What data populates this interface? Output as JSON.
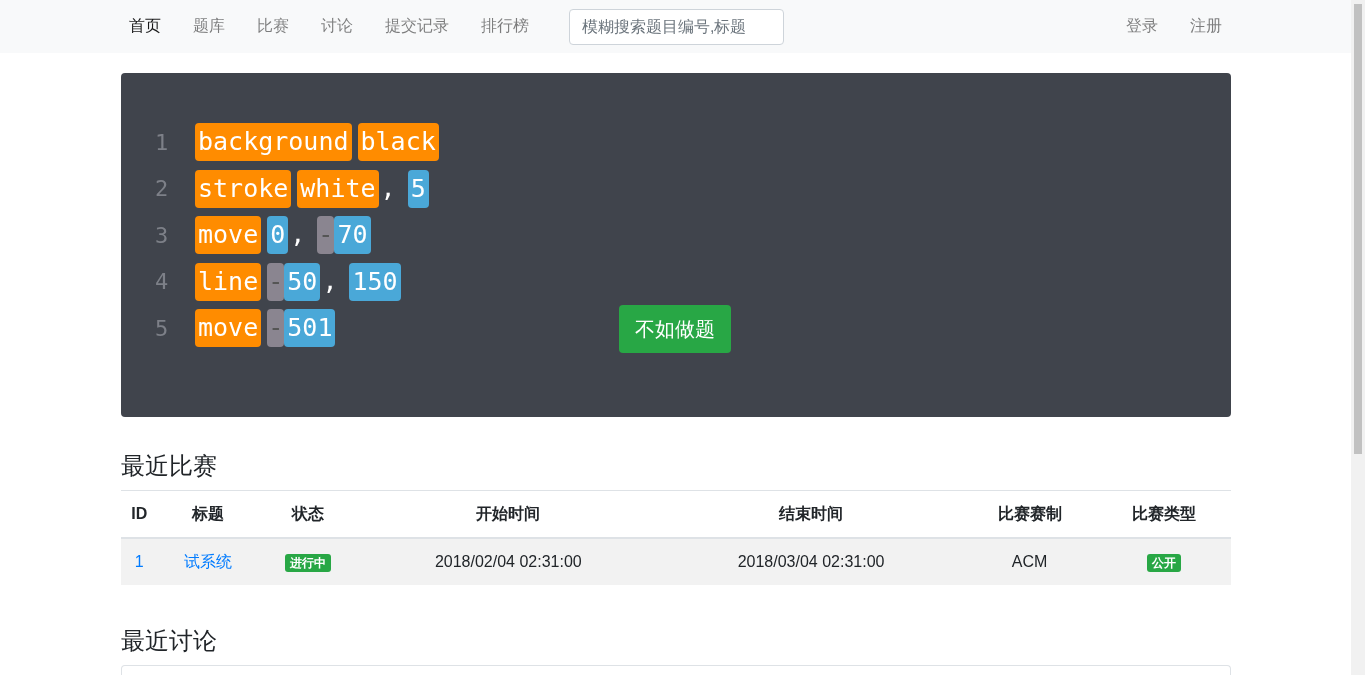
{
  "navbar": {
    "items": [
      {
        "label": "首页",
        "selected": true
      },
      {
        "label": "题库",
        "selected": false
      },
      {
        "label": "比赛",
        "selected": false
      },
      {
        "label": "讨论",
        "selected": false
      },
      {
        "label": "提交记录",
        "selected": false
      },
      {
        "label": "排行榜",
        "selected": false
      }
    ],
    "search": {
      "placeholder": "模糊搜索题目编号,标题"
    },
    "account": [
      "登录",
      "注册"
    ]
  },
  "banner": {
    "code_lines": [
      {
        "number": "1",
        "tokens": [
          {
            "kind": "keyword",
            "text": "background"
          },
          {
            "kind": "keyword",
            "text": "black"
          }
        ]
      },
      {
        "number": "2",
        "tokens": [
          {
            "kind": "keyword",
            "text": "stroke"
          },
          {
            "kind": "keyword",
            "text": "white"
          },
          {
            "kind": "punct",
            "text": ","
          },
          {
            "kind": "number",
            "text": "5"
          }
        ]
      },
      {
        "number": "3",
        "tokens": [
          {
            "kind": "keyword",
            "text": "move"
          },
          {
            "kind": "number",
            "text": "0"
          },
          {
            "kind": "punct",
            "text": ","
          },
          {
            "kind": "minus",
            "text": "-"
          },
          {
            "kind": "number",
            "text": "70"
          }
        ]
      },
      {
        "number": "4",
        "tokens": [
          {
            "kind": "keyword",
            "text": "line"
          },
          {
            "kind": "minus",
            "text": "-"
          },
          {
            "kind": "number",
            "text": "50"
          },
          {
            "kind": "punct",
            "text": ","
          },
          {
            "kind": "number",
            "text": "150"
          }
        ]
      },
      {
        "number": "5",
        "tokens": [
          {
            "kind": "keyword",
            "text": "move"
          },
          {
            "kind": "minus",
            "text": "-"
          },
          {
            "kind": "number",
            "text": "501"
          }
        ]
      }
    ],
    "button": "不如做题"
  },
  "recent_contests": {
    "title": "最近比赛",
    "columns": [
      "ID",
      "标题",
      "状态",
      "开始时间",
      "结束时间",
      "比赛赛制",
      "比赛类型"
    ],
    "rows": [
      {
        "id": "1",
        "title": "试系统",
        "status": "进行中",
        "start": "2018/02/04 02:31:00",
        "end": "2018/03/04 02:31:00",
        "format": "ACM",
        "type": "公开"
      }
    ]
  },
  "recent_discussions": {
    "title": "最近讨论"
  }
}
